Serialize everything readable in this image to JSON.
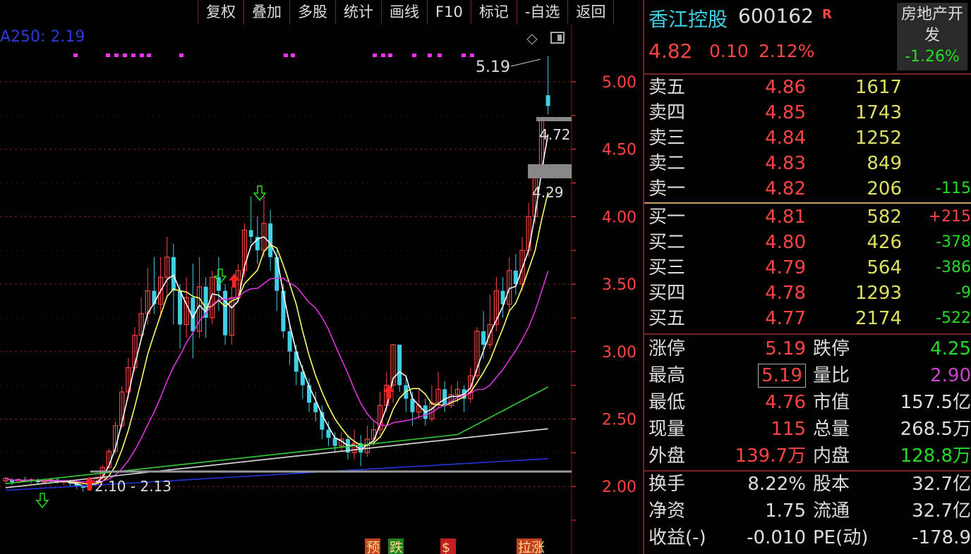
{
  "toolbar": [
    "复权",
    "叠加",
    "多股",
    "统计",
    "画线",
    "F10",
    "标记",
    "-自选",
    "返回"
  ],
  "ma_label": "A250: 2.19",
  "chart": {
    "price_labels": [
      "5.00",
      "4.50",
      "4.00",
      "3.50",
      "3.00",
      "2.50",
      "2.00"
    ],
    "annotations": {
      "high": "5.19",
      "box1": "4.72",
      "box2": "4.29",
      "range": "2.10 - 2.13"
    },
    "bottom_markers": [
      "预",
      "跌",
      "$",
      "拉涨"
    ]
  },
  "stock": {
    "name": "香江控股",
    "code": "600162",
    "badge": "R",
    "price": "4.82",
    "change": "0.10",
    "pct": "2.12%",
    "sector": "房地产开发",
    "sector_chg": "-1.26%"
  },
  "asks": [
    {
      "label": "卖五",
      "price": "4.86",
      "vol": "1617",
      "delta": ""
    },
    {
      "label": "卖四",
      "price": "4.85",
      "vol": "1743",
      "delta": ""
    },
    {
      "label": "卖三",
      "price": "4.84",
      "vol": "1252",
      "delta": ""
    },
    {
      "label": "卖二",
      "price": "4.83",
      "vol": "849",
      "delta": ""
    },
    {
      "label": "卖一",
      "price": "4.82",
      "vol": "206",
      "delta": "-115"
    }
  ],
  "bids": [
    {
      "label": "买一",
      "price": "4.81",
      "vol": "582",
      "delta": "+215"
    },
    {
      "label": "买二",
      "price": "4.80",
      "vol": "426",
      "delta": "-378"
    },
    {
      "label": "买三",
      "price": "4.79",
      "vol": "564",
      "delta": "-386"
    },
    {
      "label": "买四",
      "price": "4.78",
      "vol": "1293",
      "delta": "-9"
    },
    {
      "label": "买五",
      "price": "4.77",
      "vol": "2174",
      "delta": "-522"
    }
  ],
  "stats": [
    {
      "l1": "涨停",
      "v1": "5.19",
      "c1": "#ff4444",
      "l2": "跌停",
      "v2": "4.25",
      "c2": "#22dd22"
    },
    {
      "l1": "最高",
      "v1": "5.19",
      "c1": "#ff4444",
      "l2": "量比",
      "v2": "2.90",
      "c2": "#cc44cc"
    },
    {
      "l1": "最低",
      "v1": "4.76",
      "c1": "#ff4444",
      "l2": "市值",
      "v2": "157.5亿",
      "c2": "#ddd"
    },
    {
      "l1": "现量",
      "v1": "115",
      "c1": "#ff4444",
      "l2": "总量",
      "v2": "268.5万",
      "c2": "#ddd"
    },
    {
      "l1": "外盘",
      "v1": "139.7万",
      "c1": "#ff4444",
      "l2": "内盘",
      "v2": "128.8万",
      "c2": "#22dd22"
    }
  ],
  "fund": [
    {
      "l1": "换手",
      "v1": "8.22%",
      "l2": "股本",
      "v2": "32.7亿"
    },
    {
      "l1": "净资",
      "v1": "1.75",
      "l2": "流通",
      "v2": "32.7亿"
    },
    {
      "l1": "收益(-)",
      "v1": "-0.010",
      "l2": "PE(动)",
      "v2": "-178.9"
    }
  ],
  "colors": {
    "up": "#ff4444",
    "down": "#22dd22",
    "cyan": "#3fd0e6",
    "volume": "#e0e060"
  }
}
